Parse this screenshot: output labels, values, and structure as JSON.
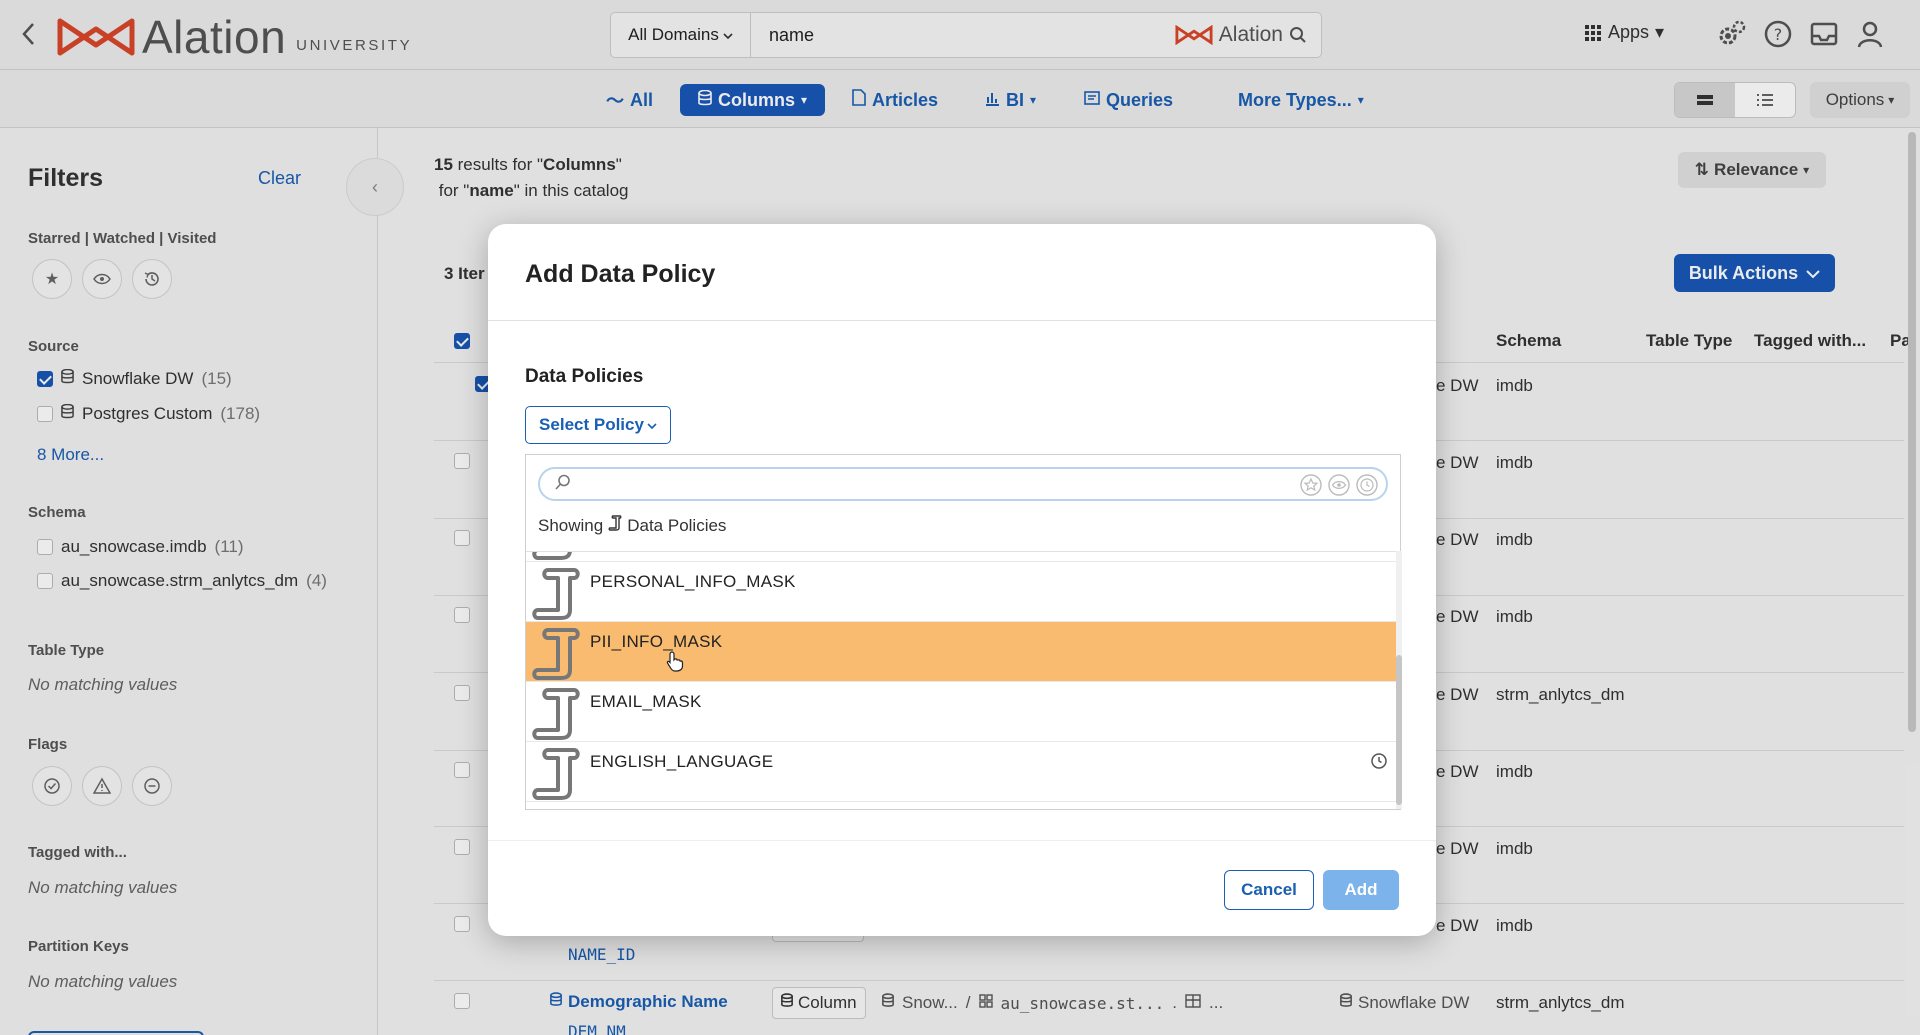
{
  "topbar": {
    "logo_word": "Alation",
    "logo_sub": "UNIVERSITY",
    "domains": "All Domains",
    "search_value": "name",
    "search_brand": "Alation",
    "apps": "Apps"
  },
  "typebar": {
    "all": "All",
    "columns": "Columns",
    "articles": "Articles",
    "bi": "BI",
    "queries": "Queries",
    "more": "More Types...",
    "options": "Options"
  },
  "sidebar": {
    "title": "Filters",
    "clear": "Clear",
    "starred_heading": "Starred | Watched | Visited",
    "source_heading": "Source",
    "sources": [
      {
        "label": "Snowflake DW",
        "count": "(15)",
        "checked": true
      },
      {
        "label": "Postgres Custom",
        "count": "(178)",
        "checked": false
      }
    ],
    "source_more": "8 More...",
    "schema_heading": "Schema",
    "schemas": [
      {
        "label": "au_snowcase.imdb",
        "count": "(11)"
      },
      {
        "label": "au_snowcase.strm_anlytcs_dm",
        "count": "(4)"
      }
    ],
    "table_type_heading": "Table Type",
    "table_type_empty": "No matching values",
    "flags_heading": "Flags",
    "tagged_heading": "Tagged with...",
    "tagged_empty": "No matching values",
    "partition_heading": "Partition Keys",
    "partition_empty": "No matching values"
  },
  "main": {
    "results_count": "15",
    "results_for": " results for \"",
    "results_type": "Columns",
    "results_close": "\"",
    "results_line2_pre": "for \"",
    "results_query": "name",
    "results_line2_post": "\" in this catalog",
    "relevance": "Relevance",
    "bulk_actions": "Bulk Actions",
    "items_label": "3 Iter",
    "columns": {
      "schema": "Schema",
      "table_type": "Table Type",
      "tagged": "Tagged with...",
      "pa": "Pa"
    },
    "row_source_suffix": "e DW",
    "rows_schema": [
      "imdb",
      "imdb",
      "imdb",
      "imdb",
      "strm_anlytcs_dm",
      "imdb",
      "imdb",
      "imdb"
    ],
    "name_id": "NAME_ID",
    "last_row": {
      "name": "Demographic Name",
      "code": "DEM_NM",
      "type": "Column",
      "source_short": "Snow...",
      "schema_short": "au_snowcase.st...",
      "table_short": "...",
      "source": "Snowflake DW",
      "schema": "strm_anlytcs_dm"
    }
  },
  "modal": {
    "title": "Add Data Policy",
    "section_label": "Data Policies",
    "select_button": "Select Policy",
    "search_placeholder": "",
    "showing_prefix": "Showing",
    "showing_type": "Data Policies",
    "items": [
      {
        "name": "PERSONAL_INFO_MASK",
        "highlighted": false
      },
      {
        "name": "PII_INFO_MASK",
        "highlighted": true
      },
      {
        "name": "EMAIL_MASK",
        "highlighted": false
      },
      {
        "name": "ENGLISH_LANGUAGE",
        "highlighted": false
      }
    ],
    "cancel": "Cancel",
    "add": "Add"
  },
  "colors": {
    "accent": "#1857b8",
    "link": "#1a5fb4",
    "highlight": "#f8bb70",
    "brand_red": "#d9472b"
  },
  "icons": [
    "back-icon",
    "alation-logo-icon",
    "search-icon",
    "apps-grid-icon",
    "settings-gears-icon",
    "help-icon",
    "inbox-icon",
    "user-icon",
    "star-icon",
    "eye-icon",
    "history-icon",
    "database-icon",
    "policy-scroll-icon",
    "clock-icon"
  ]
}
